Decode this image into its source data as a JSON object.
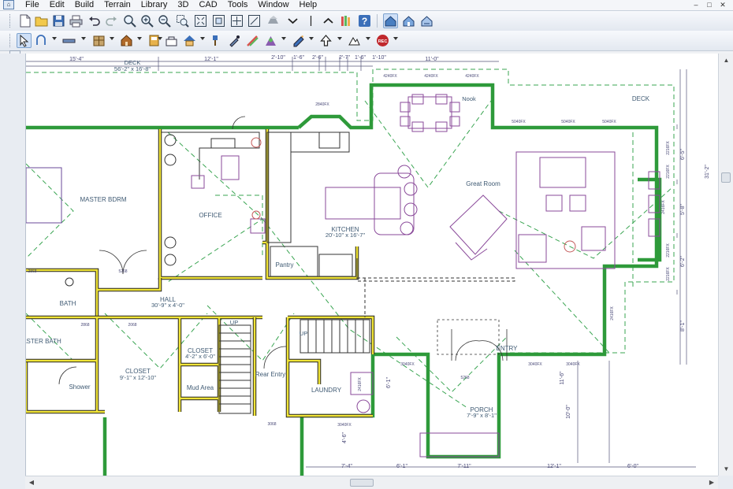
{
  "menubar": {
    "items": [
      "File",
      "Edit",
      "Build",
      "Terrain",
      "Library",
      "3D",
      "CAD",
      "Tools",
      "Window",
      "Help"
    ],
    "window_controls": {
      "minimize": "–",
      "maximize": "□",
      "close": "✕"
    }
  },
  "toolbar_row1": [
    {
      "name": "new-icon"
    },
    {
      "name": "open-icon"
    },
    {
      "name": "save-icon"
    },
    {
      "name": "print-icon"
    },
    {
      "name": "undo-icon"
    },
    {
      "name": "redo-icon"
    },
    {
      "name": "zoom-icon"
    },
    {
      "name": "zoom-in-icon"
    },
    {
      "name": "zoom-out-icon"
    },
    {
      "name": "zoom-box-icon"
    },
    {
      "name": "fill-window-icon"
    },
    {
      "name": "fill-window-building-icon"
    },
    {
      "name": "pan-icon"
    },
    {
      "name": "swap-view-icon"
    },
    {
      "name": "trees-icon"
    },
    {
      "name": "floor-down-icon"
    },
    {
      "name": "level-split-icon"
    },
    {
      "name": "floor-up-icon"
    },
    {
      "name": "library-browser-icon"
    },
    {
      "name": "help-icon"
    },
    {
      "name": "plan-view-icon"
    },
    {
      "name": "camera-view-icon"
    },
    {
      "name": "overview-icon"
    }
  ],
  "toolbar_row2": [
    {
      "name": "select-arrow-icon"
    },
    {
      "name": "edit-handles-icon"
    },
    {
      "name": "wall-tool-icon"
    },
    {
      "name": "cabinet-tool-icon"
    },
    {
      "name": "door-tool-icon"
    },
    {
      "name": "window-tool-icon"
    },
    {
      "name": "stairs-tool-icon"
    },
    {
      "name": "roof-tool-icon"
    },
    {
      "name": "paint-brush-icon"
    },
    {
      "name": "material-eyedropper-icon"
    },
    {
      "name": "color-palette-icon"
    },
    {
      "name": "camera-tool-icon"
    },
    {
      "name": "text-tool-icon"
    },
    {
      "name": "arrow-up-tool-icon"
    },
    {
      "name": "terrain-tool-icon"
    },
    {
      "name": "record-icon"
    }
  ],
  "rooms": {
    "deck_left": {
      "name": "DECK",
      "dims": "56'-2\" x 16'-8\""
    },
    "deck_right": {
      "name": "DECK"
    },
    "nook": {
      "name": "Nook"
    },
    "master": {
      "name": "MASTER BDRM"
    },
    "office": {
      "name": "OFFICE"
    },
    "kitchen": {
      "name": "KITCHEN",
      "dims": "20'-10\" x 16'-7\""
    },
    "great_room": {
      "name": "Great Room"
    },
    "pantry": {
      "name": "Pantry"
    },
    "hall": {
      "name": "HALL",
      "dims": "30'-9\" x 4'-0\""
    },
    "bath": {
      "name": "BATH"
    },
    "master_bath": {
      "name": "ASTER BATH"
    },
    "closet_main": {
      "name": "CLOSET",
      "dims": "9'-1\" x 12'-10\""
    },
    "closet_small": {
      "name": "CLOSET",
      "dims": "4'-2\" x 6'-0\""
    },
    "shower": {
      "name": "Shower"
    },
    "mud": {
      "name": "Mud Area"
    },
    "rear_entry": {
      "name": "Rear Entry"
    },
    "laundry": {
      "name": "LAUNDRY"
    },
    "entry": {
      "name": "ENTRY"
    },
    "porch": {
      "name": "PORCH",
      "dims": "7'-9\" x 8'-1\""
    },
    "stairs_up": {
      "name": "UP"
    },
    "stairs_up2": {
      "name": "UP"
    }
  },
  "dimensions": {
    "top": [
      "15'-4\"",
      "12'-1\"",
      "2'-10\"",
      "1'-6\"",
      "2'-6\"",
      "2'-7\"",
      "1'-6\"",
      "1'-10\"",
      "11'-0\""
    ],
    "right": [
      "31'-2\"",
      "6'-5\"",
      "5'-8\"",
      "6'-2\"",
      "8'-1\""
    ],
    "bottom": [
      "7'-4\"",
      "6'-1\"",
      "7'-11\"",
      "12'-1\"",
      "6'-0\""
    ],
    "porch_vertical": [
      "10'-0\"",
      "11'-6\""
    ],
    "misc": [
      "6'-1\"",
      "4'-6\""
    ]
  },
  "window_labels": [
    "4240FX",
    "4240FX",
    "4240FX",
    "2840FX",
    "5040FX",
    "5040FX",
    "5040FX",
    "3040FX",
    "3040FX",
    "3040FX",
    "3040FX",
    "2216FX",
    "2216FX",
    "2216FX",
    "2216FX",
    "2416FX",
    "2416FX",
    "2416FX",
    "5268",
    "2868",
    "2068",
    "2868",
    "3068",
    "5268"
  ]
}
